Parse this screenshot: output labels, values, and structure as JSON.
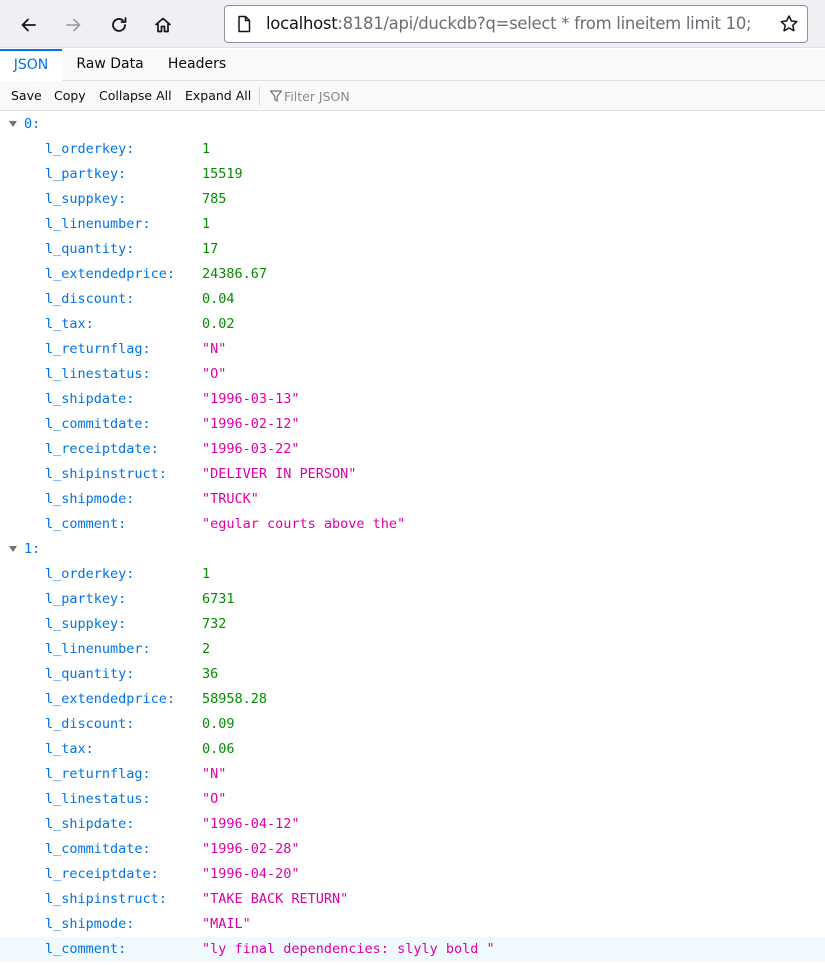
{
  "browser": {
    "url_host": "localhost",
    "url_rest": ":8181/api/duckdb?q=select * from lineitem limit 10;"
  },
  "tabs": [
    {
      "label": "JSON",
      "active": true
    },
    {
      "label": "Raw Data",
      "active": false
    },
    {
      "label": "Headers",
      "active": false
    }
  ],
  "toolbar": {
    "save_label": "Save",
    "copy_label": "Copy",
    "collapse_label": "Collapse All",
    "expand_label": "Expand All",
    "filter_placeholder": "Filter JSON"
  },
  "records": [
    {
      "index_label": "0:",
      "fields": [
        {
          "key": "l_orderkey:",
          "value": "1",
          "type": "num"
        },
        {
          "key": "l_partkey:",
          "value": "15519",
          "type": "num"
        },
        {
          "key": "l_suppkey:",
          "value": "785",
          "type": "num"
        },
        {
          "key": "l_linenumber:",
          "value": "1",
          "type": "num"
        },
        {
          "key": "l_quantity:",
          "value": "17",
          "type": "num"
        },
        {
          "key": "l_extendedprice:",
          "value": "24386.67",
          "type": "num"
        },
        {
          "key": "l_discount:",
          "value": "0.04",
          "type": "num"
        },
        {
          "key": "l_tax:",
          "value": "0.02",
          "type": "num"
        },
        {
          "key": "l_returnflag:",
          "value": "\"N\"",
          "type": "str"
        },
        {
          "key": "l_linestatus:",
          "value": "\"O\"",
          "type": "str"
        },
        {
          "key": "l_shipdate:",
          "value": "\"1996-03-13\"",
          "type": "str"
        },
        {
          "key": "l_commitdate:",
          "value": "\"1996-02-12\"",
          "type": "str"
        },
        {
          "key": "l_receiptdate:",
          "value": "\"1996-03-22\"",
          "type": "str"
        },
        {
          "key": "l_shipinstruct:",
          "value": "\"DELIVER IN PERSON\"",
          "type": "str"
        },
        {
          "key": "l_shipmode:",
          "value": "\"TRUCK\"",
          "type": "str"
        },
        {
          "key": "l_comment:",
          "value": "\"egular courts above the\"",
          "type": "str"
        }
      ]
    },
    {
      "index_label": "1:",
      "fields": [
        {
          "key": "l_orderkey:",
          "value": "1",
          "type": "num"
        },
        {
          "key": "l_partkey:",
          "value": "6731",
          "type": "num"
        },
        {
          "key": "l_suppkey:",
          "value": "732",
          "type": "num"
        },
        {
          "key": "l_linenumber:",
          "value": "2",
          "type": "num"
        },
        {
          "key": "l_quantity:",
          "value": "36",
          "type": "num"
        },
        {
          "key": "l_extendedprice:",
          "value": "58958.28",
          "type": "num"
        },
        {
          "key": "l_discount:",
          "value": "0.09",
          "type": "num"
        },
        {
          "key": "l_tax:",
          "value": "0.06",
          "type": "num"
        },
        {
          "key": "l_returnflag:",
          "value": "\"N\"",
          "type": "str"
        },
        {
          "key": "l_linestatus:",
          "value": "\"O\"",
          "type": "str"
        },
        {
          "key": "l_shipdate:",
          "value": "\"1996-04-12\"",
          "type": "str"
        },
        {
          "key": "l_commitdate:",
          "value": "\"1996-02-28\"",
          "type": "str"
        },
        {
          "key": "l_receiptdate:",
          "value": "\"1996-04-20\"",
          "type": "str"
        },
        {
          "key": "l_shipinstruct:",
          "value": "\"TAKE BACK RETURN\"",
          "type": "str"
        },
        {
          "key": "l_shipmode:",
          "value": "\"MAIL\"",
          "type": "str"
        },
        {
          "key": "l_comment:",
          "value": "\"ly final dependencies: slyly bold \"",
          "type": "str",
          "highlighted": true
        }
      ]
    }
  ]
}
